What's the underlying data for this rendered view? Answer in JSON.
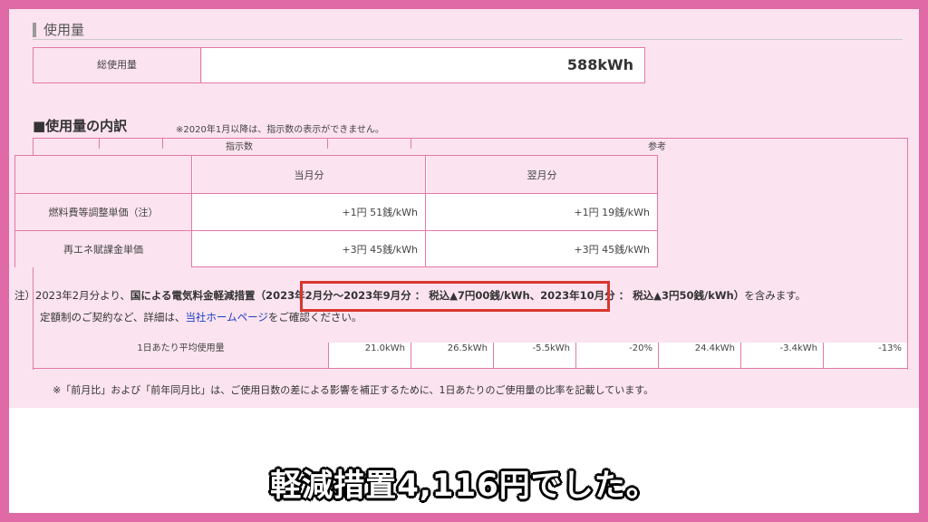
{
  "usage_section": {
    "heading": "使用量"
  },
  "total": {
    "label": "総使用量",
    "value": "588kWh"
  },
  "breakdown": {
    "heading": "■使用量の内訳",
    "note": "※2020年1月以降は、指示数の表示ができません。",
    "back_headers": [
      "指示数",
      "参考"
    ]
  },
  "unit_price_table": {
    "headers": [
      "",
      "当月分",
      "翌月分"
    ],
    "rows": [
      {
        "label": "燃料費等調整単価（注）",
        "current": "+1円 51銭/kWh",
        "next": "+1円 19銭/kWh"
      },
      {
        "label": "再エネ賦課金単価",
        "current": "+3円 45銭/kWh",
        "next": "+3円 45銭/kWh"
      }
    ]
  },
  "note1": {
    "prefix": "注）2023年2月分より、",
    "bold1": "国による電気料金軽減措置",
    "bold2": "（2023年2月分〜2023年9月分 ： 税込▲7円00銭/kWh、2023年10月分 ： 税込▲3円50銭/kWh）",
    "suffix": "を含みます。"
  },
  "note2": {
    "prefix": "定額制のご契約など、詳細は、",
    "link": "当社ホームページ",
    "suffix": "をご確認ください。"
  },
  "avg_row": {
    "label": "1日あたり平均使用量",
    "values": [
      "21.0kWh",
      "26.5kWh",
      "-5.5kWh",
      "-20%",
      "24.4kWh",
      "-3.4kWh",
      "-13%"
    ]
  },
  "footnote": "※「前月比」および「前年同月比」は、ご使用日数の差による影響を補正するために、1日あたりのご使用量の比率を記載しています。",
  "subtitle": "軽減措置4,116円でした。",
  "colors": {
    "frame": "#e06aa6",
    "panel": "#fbe3ef",
    "border": "#e07aa7",
    "highlight": "#d9362f",
    "link": "#1a3fc4"
  }
}
